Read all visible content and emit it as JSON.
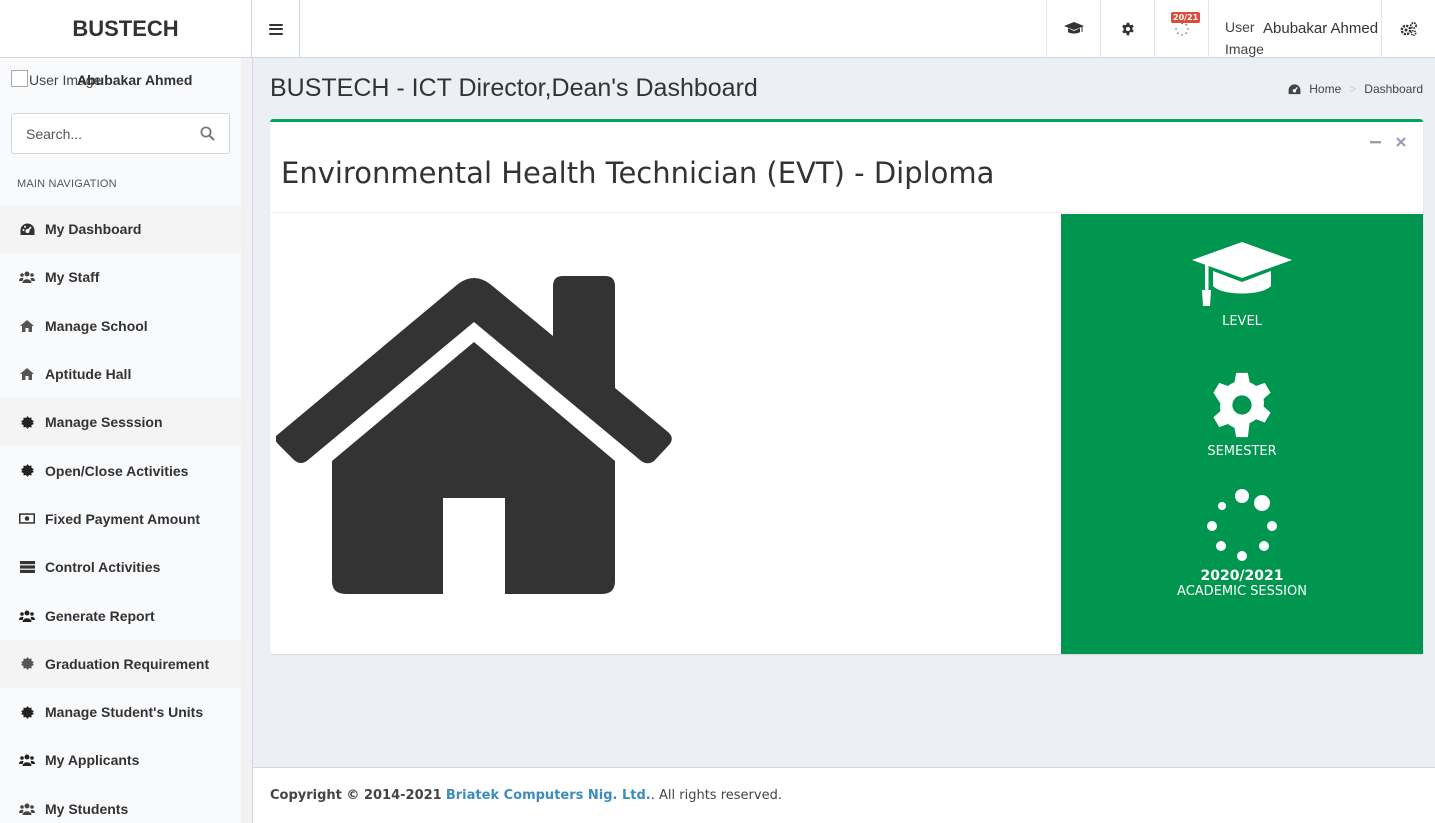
{
  "header": {
    "logo": "BUSTECH",
    "badge": "20/21",
    "user_image_alt": "User Image",
    "user_name": "Abubakar Ahmed"
  },
  "sidebar": {
    "user_image_alt": "User Image",
    "user_name": "Abubakar Ahmed",
    "search_placeholder": "Search...",
    "nav_header": "MAIN NAVIGATION",
    "items": [
      {
        "label": "My Dashboard",
        "icon": "dashboard-icon"
      },
      {
        "label": "My Staff",
        "icon": "users-icon"
      },
      {
        "label": "Manage School",
        "icon": "home-icon"
      },
      {
        "label": "Aptitude Hall",
        "icon": "home-icon"
      },
      {
        "label": "Manage Sesssion",
        "icon": "certificate-icon"
      },
      {
        "label": "Open/Close Activities",
        "icon": "certificate-icon"
      },
      {
        "label": "Fixed Payment Amount",
        "icon": "money-icon"
      },
      {
        "label": "Control Activities",
        "icon": "server-icon"
      },
      {
        "label": "Generate Report",
        "icon": "users-icon"
      },
      {
        "label": "Graduation Requirement",
        "icon": "gear-icon"
      },
      {
        "label": "Manage Student's Units",
        "icon": "certificate-icon"
      },
      {
        "label": "My Applicants",
        "icon": "users-icon"
      },
      {
        "label": "My Students",
        "icon": "users-icon"
      }
    ]
  },
  "content": {
    "title": "BUSTECH - ICT Director,Dean's Dashboard",
    "breadcrumb": {
      "home": "Home",
      "current": "Dashboard"
    }
  },
  "box": {
    "title": "Environmental Health Technician (EVT) - Diploma",
    "stats": {
      "level_label": "LEVEL",
      "semester_label": "SEMESTER",
      "session_value": "2020/2021",
      "session_label": "ACADEMIC SESSION"
    }
  },
  "footer": {
    "copyright": "Copyright © 2014-2021",
    "company": "Briatek Computers Nig. Ltd.",
    "rights": ". All rights reserved."
  },
  "colors": {
    "accent_green": "#00964f",
    "box_border": "#00a65a",
    "link": "#3c8dbc",
    "badge": "#dd4b39"
  }
}
